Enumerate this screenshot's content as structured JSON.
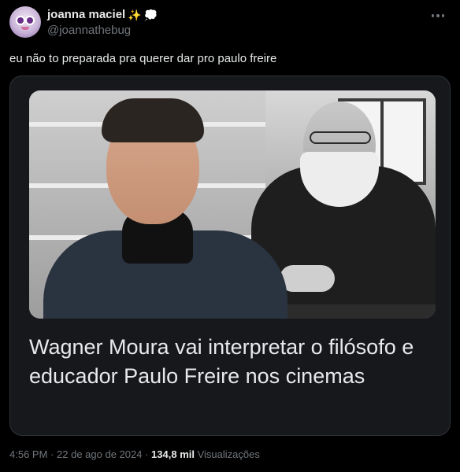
{
  "author": {
    "display_name": "joanna maciel",
    "emoji_1": "✨",
    "emoji_2": "💭",
    "handle": "@joannathebug"
  },
  "tweet": {
    "text": "eu não to preparada pra querer dar pro paulo freire"
  },
  "card": {
    "headline": "Wagner Moura vai interpretar o filósofo e educador Paulo Freire nos cinemas"
  },
  "meta": {
    "time": "4:56 PM",
    "separator": "·",
    "date": "22 de ago de 2024",
    "views_count": "134,8 mil",
    "views_label": "Visualizações"
  },
  "icons": {
    "more": "more-horizontal-icon"
  },
  "colors": {
    "background": "#000000",
    "text": "#e7e9ea",
    "secondary": "#71767b",
    "card_border": "#2f3336",
    "card_background": "#16181c"
  }
}
